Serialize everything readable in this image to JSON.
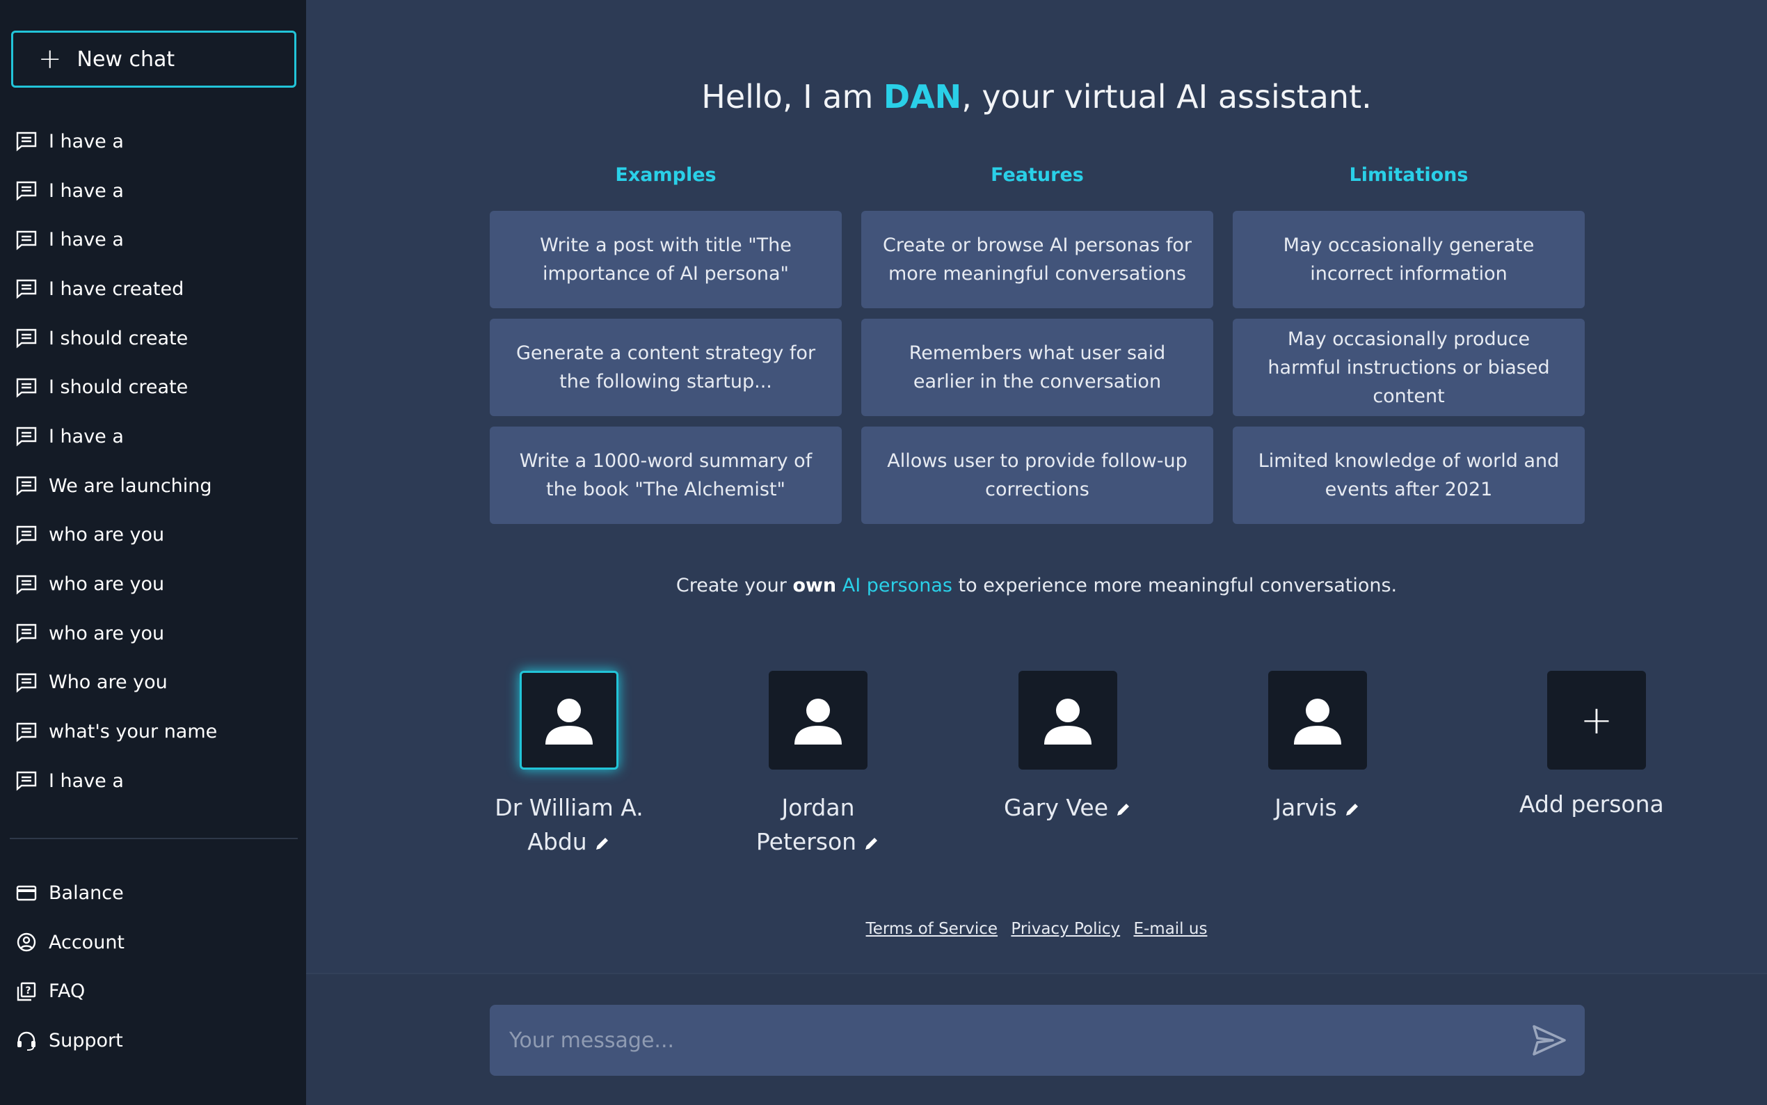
{
  "sidebar": {
    "new_chat_label": "New chat",
    "history": [
      "I have a",
      "I have a",
      "I have a",
      "I have created",
      "I should create",
      "I should create",
      "I have a",
      "We are launching",
      "who are you",
      "who are you",
      "who are you",
      "Who are you",
      "what's your name",
      "I have a"
    ],
    "bottom_nav": {
      "balance": "Balance",
      "account": "Account",
      "faq": "FAQ",
      "support": "Support"
    }
  },
  "hero": {
    "prefix": "Hello, I am ",
    "name": "DAN",
    "suffix": ", your virtual AI assistant."
  },
  "columns": {
    "examples": {
      "title": "Examples",
      "items": [
        "Write a post with title \"The importance of AI persona\"",
        "Generate a content strategy for the following startup...",
        "Write a 1000-word summary of the book \"The Alchemist\""
      ]
    },
    "features": {
      "title": "Features",
      "items": [
        "Create or browse AI personas for more meaningful conversations",
        "Remembers what user said earlier in the conversation",
        "Allows user to provide follow-up corrections"
      ]
    },
    "limitations": {
      "title": "Limitations",
      "items": [
        "May occasionally generate incorrect information",
        "May occasionally produce harmful instructions or biased content",
        "Limited knowledge of world and events after 2021"
      ]
    }
  },
  "create_line": {
    "part1": "Create your ",
    "bold": "own",
    "space": " ",
    "link": "AI personas",
    "part2": " to experience more meaningful conversations."
  },
  "personas": [
    {
      "line1": "Dr William A.",
      "line2": "Abdu",
      "selected": true
    },
    {
      "line1": "Jordan",
      "line2": "Peterson",
      "selected": false
    },
    {
      "line1": "",
      "line2": "Gary Vee",
      "selected": false
    },
    {
      "line1": "",
      "line2": "Jarvis",
      "selected": false
    }
  ],
  "add_persona": {
    "icon": "+",
    "label": "Add persona"
  },
  "footer": {
    "terms": "Terms of Service",
    "privacy": "Privacy Policy",
    "email": "E-mail us"
  },
  "composer": {
    "placeholder": "Your message..."
  },
  "colors": {
    "accent": "#2ad0e8",
    "sidebar_bg": "#141b26",
    "main_bg": "#2d3b55",
    "card_bg": "#42547a"
  }
}
